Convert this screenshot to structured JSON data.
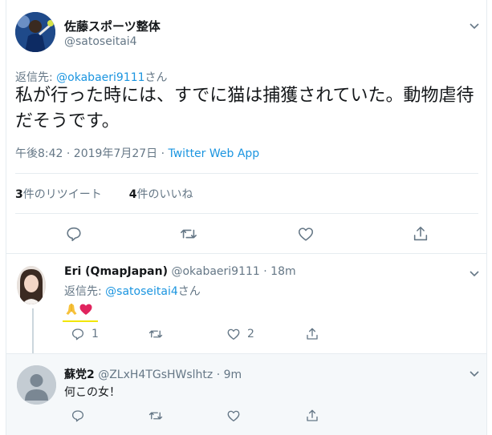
{
  "main_tweet": {
    "display_name": "佐藤スポーツ整体",
    "handle": "@satoseitai4",
    "reply_prefix": "返信先: ",
    "reply_handle": "@okabaeri9111",
    "reply_suffix": "さん",
    "text": "私が行った時には、すでに猫は捕獲されていた。動物虐待だそうです。",
    "timestamp": "午後8:42 · 2019年7月27日 · ",
    "source": "Twitter Web App",
    "retweets_count": "3",
    "retweets_label": "件のリツイート",
    "likes_count": "4",
    "likes_label": "件のいいね"
  },
  "reply_1": {
    "display_name": "Eri (QmapJapan)",
    "handle": "@okabaeri9111",
    "time": " · 18m",
    "reply_prefix": "返信先: ",
    "reply_handle": "@satoseitai4",
    "reply_suffix": "さん",
    "text": "🙏❤",
    "reply_count": "1",
    "retweet_count": "",
    "like_count": "2"
  },
  "reply_2": {
    "display_name": "蘇党2",
    "handle": "@ZLxH4TGsHWslhtz",
    "time": " · 9m",
    "text": "何この女！"
  },
  "colors": {
    "link": "#1b95e0",
    "secondary_text": "#657786",
    "divider": "#e6ecf0",
    "highlight": "#f2e600",
    "heart": "#e0245e"
  },
  "icons": [
    "chevron-down-icon",
    "reply-icon",
    "retweet-icon",
    "like-icon",
    "share-icon"
  ]
}
